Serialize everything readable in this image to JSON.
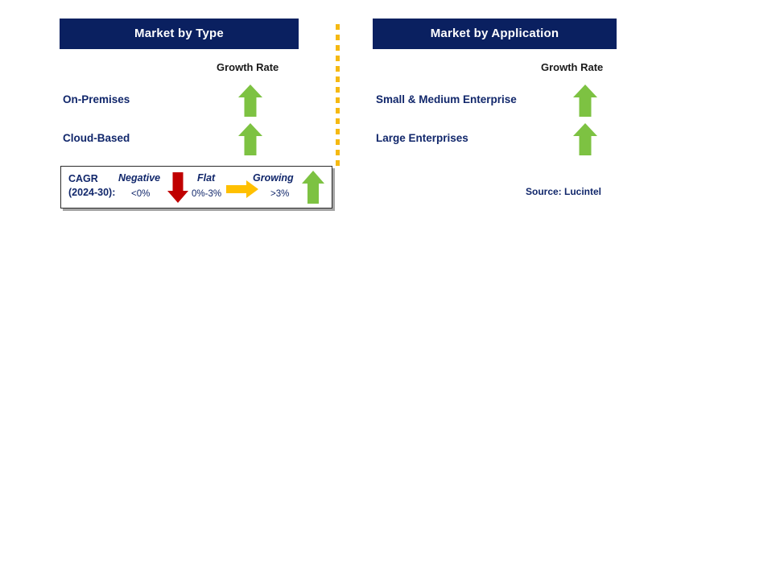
{
  "chart_data": {
    "type": "table",
    "title": "Market Segmentation Growth Rate Overview",
    "panels": [
      {
        "title": "Market by Type",
        "column_header": "Growth Rate",
        "rows": [
          {
            "label": "On-Premises",
            "growth": "Growing",
            "indicator": "up-arrow",
            "color": "#7dc242"
          },
          {
            "label": "Cloud-Based",
            "growth": "Growing",
            "indicator": "up-arrow",
            "color": "#7dc242"
          }
        ]
      },
      {
        "title": "Market by Application",
        "column_header": "Growth Rate",
        "rows": [
          {
            "label": "Small & Medium Enterprise",
            "growth": "Growing",
            "indicator": "up-arrow",
            "color": "#7dc242"
          },
          {
            "label": "Large Enterprises",
            "growth": "Growing",
            "indicator": "up-arrow",
            "color": "#7dc242"
          }
        ]
      }
    ],
    "legend": {
      "title_line1": "CAGR",
      "title_line2": "(2024-30):",
      "entries": [
        {
          "term": "Negative",
          "range": "<0%",
          "indicator": "down-arrow",
          "color": "#c00000"
        },
        {
          "term": "Flat",
          "range": "0%-3%",
          "indicator": "right-arrow",
          "color": "#ffc000"
        },
        {
          "term": "Growing",
          "range": ">3%",
          "indicator": "up-arrow",
          "color": "#7dc242"
        }
      ]
    },
    "source": "Source: Lucintel"
  },
  "panels": {
    "type": {
      "title": "Market by Type",
      "growth_rate_label": "Growth Rate",
      "rows": [
        {
          "label": "On-Premises"
        },
        {
          "label": "Cloud-Based"
        }
      ]
    },
    "application": {
      "title": "Market by Application",
      "growth_rate_label": "Growth Rate",
      "rows": [
        {
          "label": "Small & Medium Enterprise"
        },
        {
          "label": "Large Enterprises"
        }
      ]
    }
  },
  "legend": {
    "cagr_line1": "CAGR",
    "cagr_line2": "(2024-30):",
    "negative_term": "Negative",
    "negative_range": "<0%",
    "flat_term": "Flat",
    "flat_range": "0%-3%",
    "growing_term": "Growing",
    "growing_range": ">3%"
  },
  "source": {
    "text": "Source: Lucintel"
  },
  "colors": {
    "header_navy": "#0a2060",
    "text_navy": "#11276b",
    "arrow_green": "#7dc242",
    "arrow_red": "#c00000",
    "arrow_yellow": "#ffc000",
    "divider_amber": "#f5b912"
  }
}
